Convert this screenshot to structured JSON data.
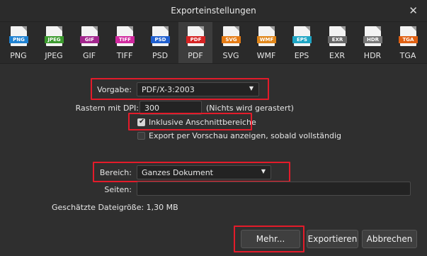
{
  "window": {
    "title": "Exporteinstellungen",
    "close_glyph": "✕"
  },
  "formats": [
    {
      "label": "PNG",
      "tag": "PNG",
      "color": "#1f82d2",
      "icon": "png-file-icon"
    },
    {
      "label": "JPEG",
      "tag": "JPEG",
      "color": "#3b9a2e",
      "icon": "jpeg-file-icon"
    },
    {
      "label": "GIF",
      "tag": "GIF",
      "color": "#a2258d",
      "icon": "gif-file-icon"
    },
    {
      "label": "TIFF",
      "tag": "TIFF",
      "color": "#d0289e",
      "icon": "tiff-file-icon"
    },
    {
      "label": "PSD",
      "tag": "PSD",
      "color": "#1f5fcf",
      "icon": "psd-file-icon"
    },
    {
      "label": "PDF",
      "tag": "PDF",
      "color": "#d62323",
      "icon": "pdf-file-icon"
    },
    {
      "label": "SVG",
      "tag": "SVG",
      "color": "#e57b14",
      "icon": "svg-file-icon"
    },
    {
      "label": "WMF",
      "tag": "WMF",
      "color": "#e0861a",
      "icon": "wmf-file-icon"
    },
    {
      "label": "EPS",
      "tag": "EPS",
      "color": "#1ea5c4",
      "icon": "eps-file-icon"
    },
    {
      "label": "EXR",
      "tag": "EXR",
      "color": "#666666",
      "icon": "exr-file-icon"
    },
    {
      "label": "HDR",
      "tag": "HDR",
      "color": "#777777",
      "icon": "hdr-file-icon"
    },
    {
      "label": "TGA",
      "tag": "TGA",
      "color": "#e06012",
      "icon": "tga-file-icon"
    }
  ],
  "selected_format": "PDF",
  "settings": {
    "preset_label": "Vorgabe:",
    "preset_value": "PDF/X-3:2003",
    "raster_label": "Rastern mit DPI:",
    "raster_value": "300",
    "raster_note": "(Nichts wird gerastert)",
    "bleed_label": "Inklusive Anschnittbereiche",
    "bleed_checked": true,
    "preview_label": "Export per Vorschau anzeigen, sobald vollständig",
    "preview_checked": false,
    "range_label": "Bereich:",
    "range_value": "Ganzes Dokument",
    "pages_label": "Seiten:",
    "pages_value": "",
    "filesize_text": "Geschätzte Dateigröße: 1,30 MB"
  },
  "buttons": {
    "more": "Mehr...",
    "export": "Exportieren",
    "cancel": "Abbrechen"
  },
  "highlight_color": "#e31b2a"
}
